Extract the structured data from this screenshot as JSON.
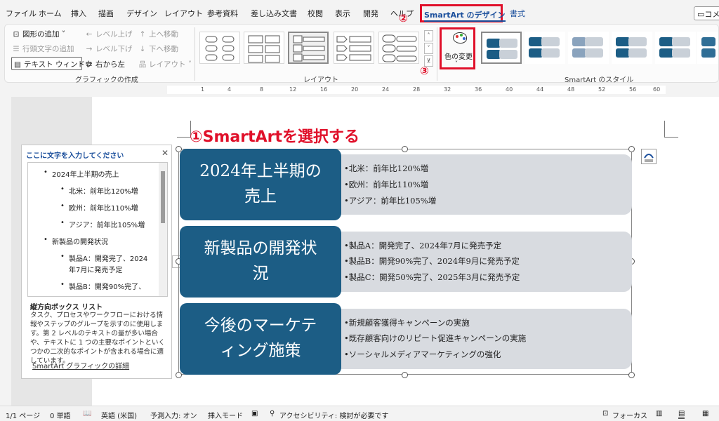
{
  "menu": {
    "items": [
      "ファイル",
      "ホーム",
      "挿入",
      "描画",
      "デザイン",
      "レイアウト",
      "参考資料",
      "差し込み文書",
      "校閲",
      "表示",
      "開発",
      "ヘルプ"
    ],
    "active_tab": "SmartArt のデザイン",
    "format_tab": "書式",
    "comment_button": "コメント"
  },
  "ribbon": {
    "create_graphic": {
      "add_shape": "図形の追加",
      "add_bullet": "行頭文字の追加",
      "text_pane": "テキスト ウィンドウ",
      "promote": "レベル上げ",
      "demote": "レベル下げ",
      "right_to_left": "右から左",
      "move_up": "上へ移動",
      "move_down": "下へ移動",
      "layout": "レイアウト",
      "group_label": "グラフィックの作成"
    },
    "layouts_label": "レイアウト",
    "change_colors": "色の変更",
    "styles_label": "SmartArt のスタイル"
  },
  "annotations": {
    "step1": "①SmartArtを選択する",
    "step2": "②",
    "step3": "③"
  },
  "text_pane": {
    "title": "ここに文字を入力してください",
    "items": [
      "2024年上半期の売上",
      "北米：前年比120%増",
      "欧州：前年比110%増",
      "アジア：前年比105%増",
      "新製品の開発状況",
      "製品A：開発完了、2024",
      "年7月に発売予定",
      "製品B：開発90%完了、"
    ],
    "desc_title": "縦方向ボックス リスト",
    "desc": "タスク、プロセスやワークフローにおける情報やステップのグループを示すのに使用します。第 2 レベルのテキストの量が多い場合や、テキストに 1 つの主要なポイントといくつかの二次的なポイントが含まれる場合に適しています。",
    "link": "SmartArt グラフィックの詳細"
  },
  "smartart": {
    "rows": [
      {
        "heading": [
          "2024年上半期の",
          "売上"
        ],
        "bullets": [
          "•北米：前年比120%増",
          "•欧州：前年比110%増",
          "•アジア：前年比105%増"
        ]
      },
      {
        "heading": [
          "新製品の開発状",
          "況"
        ],
        "bullets": [
          "•製品A：開発完了、2024年7月に発売予定",
          "•製品B：開発90%完了、2024年9月に発売予定",
          "•製品C：開発50%完了、2025年3月に発売予定"
        ]
      },
      {
        "heading": [
          "今後のマーケテ",
          "ィング施策"
        ],
        "bullets": [
          "•新規顧客獲得キャンペーンの実施",
          "•既存顧客向けのリピート促進キャンペーンの実施",
          "•ソーシャルメディアマーケティングの強化"
        ]
      }
    ]
  },
  "status": {
    "page": "1/1 ページ",
    "words": "0 単語",
    "language": "英語 (米国)",
    "predict": "予測入力: オン",
    "insert_mode": "挿入モード",
    "accessibility": "アクセシビリティ: 検討が必要です",
    "focus": "フォーカス"
  },
  "colors": {
    "accent_red": "#e0102a",
    "smartart_blue": "#1c5d85",
    "panel_gray": "#d8dbe0",
    "tab_blue": "#1b4f9c"
  }
}
